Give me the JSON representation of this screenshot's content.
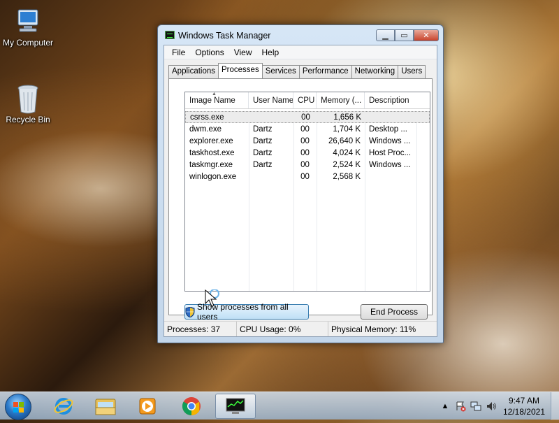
{
  "desktop": {
    "icons": [
      {
        "label": "My Computer"
      },
      {
        "label": "Recycle Bin"
      }
    ]
  },
  "window": {
    "title": "Windows Task Manager",
    "menu": [
      "File",
      "Options",
      "View",
      "Help"
    ],
    "tabs": [
      "Applications",
      "Processes",
      "Services",
      "Performance",
      "Networking",
      "Users"
    ],
    "active_tab": "Processes",
    "columns": [
      "Image Name",
      "User Name",
      "CPU",
      "Memory (...",
      "Description"
    ],
    "rows": [
      {
        "image": "csrss.exe",
        "user": "",
        "cpu": "00",
        "memory": "1,656 K",
        "description": ""
      },
      {
        "image": "dwm.exe",
        "user": "Dartz",
        "cpu": "00",
        "memory": "1,704 K",
        "description": "Desktop ..."
      },
      {
        "image": "explorer.exe",
        "user": "Dartz",
        "cpu": "00",
        "memory": "26,640 K",
        "description": "Windows ..."
      },
      {
        "image": "taskhost.exe",
        "user": "Dartz",
        "cpu": "00",
        "memory": "4,024 K",
        "description": "Host Proc..."
      },
      {
        "image": "taskmgr.exe",
        "user": "Dartz",
        "cpu": "00",
        "memory": "2,524 K",
        "description": "Windows ..."
      },
      {
        "image": "winlogon.exe",
        "user": "",
        "cpu": "00",
        "memory": "2,568 K",
        "description": ""
      }
    ],
    "show_all_button": "Show processes from all users",
    "end_process_button": "End Process",
    "status": {
      "processes": "Processes: 37",
      "cpu": "CPU Usage: 0%",
      "memory": "Physical Memory: 11%"
    }
  },
  "taskbar": {
    "apps": [
      "start-orb",
      "internet-explorer",
      "windows-explorer",
      "media-player",
      "chrome",
      "task-manager"
    ],
    "clock_time": "9:47 AM",
    "clock_date": "12/18/2021"
  }
}
